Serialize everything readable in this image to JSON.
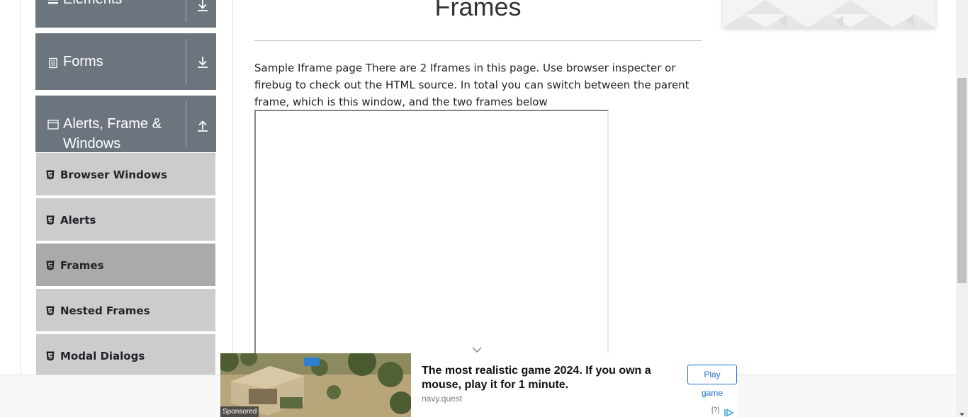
{
  "sidebar": {
    "groups": [
      {
        "label": "Elements",
        "icon": "list-icon",
        "toggle_icon": "expand-down-icon"
      },
      {
        "label": "Forms",
        "icon": "document-icon",
        "toggle_icon": "expand-down-icon"
      },
      {
        "label_line1": "Alerts, Frame &",
        "label_line2": "Windows",
        "icon": "window-icon",
        "toggle_icon": "collapse-up-icon"
      }
    ],
    "items": [
      {
        "label": "Browser Windows",
        "icon": "html5-icon",
        "active": false
      },
      {
        "label": "Alerts",
        "icon": "html5-icon",
        "active": false
      },
      {
        "label": "Frames",
        "icon": "html5-icon",
        "active": true
      },
      {
        "label": "Nested Frames",
        "icon": "html5-icon",
        "active": false
      },
      {
        "label": "Modal Dialogs",
        "icon": "html5-icon",
        "active": false
      }
    ]
  },
  "main": {
    "title": "Frames",
    "intro": "Sample Iframe page There are 2 Iframes in this page. Use browser inspecter or firebug to check out the HTML source. In total you can switch between the parent frame, which is this window, and the two frames below"
  },
  "ad": {
    "headline": "The most realistic game 2024. If you own a mouse, play it for 1 minute.",
    "domain": "navy.quest",
    "cta": "Play game",
    "sponsored": "Sponsored",
    "help": "[?]"
  },
  "colors": {
    "group_header_bg": "#6c757d",
    "menu_item_bg": "#cccccc",
    "menu_item_active_bg": "#aaaaaa",
    "ad_accent": "#2a6fd6"
  }
}
